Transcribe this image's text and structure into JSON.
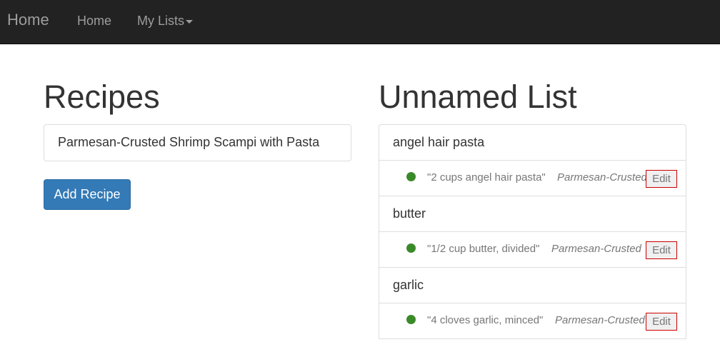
{
  "navbar": {
    "brand": "Home",
    "home_link": "Home",
    "lists_link": "My Lists"
  },
  "recipes": {
    "heading": "Recipes",
    "selected_recipe": "Parmesan-Crusted Shrimp Scampi with Pasta",
    "add_button": "Add Recipe"
  },
  "list": {
    "heading": "Unnamed List",
    "items": [
      {
        "ingredient": "angel hair pasta",
        "quantity": "\"2 cups angel hair pasta\"",
        "source": "Parmesan-Crusted Shrimp Scampi with Pasta",
        "edit": "Edit"
      },
      {
        "ingredient": "butter",
        "quantity": "\"1/2 cup butter, divided\"",
        "source": "Parmesan-Crusted Shrimp Scampi with Pasta",
        "edit": "Edit"
      },
      {
        "ingredient": "garlic",
        "quantity": "\"4 cloves garlic, minced\"",
        "source": "Parmesan-Crusted Shrimp Scampi with Pasta",
        "edit": "Edit"
      }
    ]
  },
  "colors": {
    "navbar_bg": "#222222",
    "primary": "#337ab7",
    "status_dot": "#3b8a2a",
    "edit_border": "#cc0000"
  }
}
